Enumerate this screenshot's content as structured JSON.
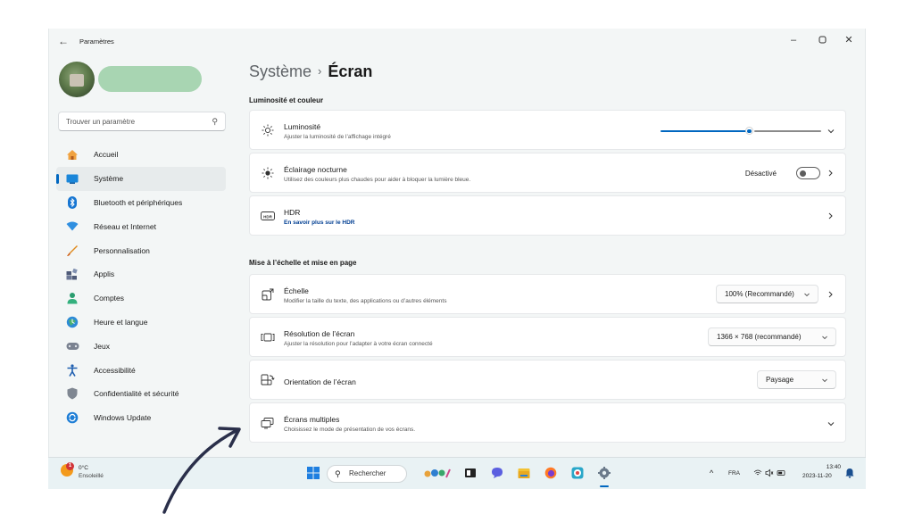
{
  "window": {
    "app_title": "Paramètres",
    "controls": {
      "minimize": "–",
      "maximize": "▢",
      "close": "✕"
    }
  },
  "sidebar": {
    "search_placeholder": "Trouver un paramètre",
    "items": [
      {
        "label": "Accueil",
        "icon": "home-icon",
        "active": false
      },
      {
        "label": "Système",
        "icon": "system-icon",
        "active": true
      },
      {
        "label": "Bluetooth et périphériques",
        "icon": "bluetooth-icon",
        "active": false
      },
      {
        "label": "Réseau et Internet",
        "icon": "network-icon",
        "active": false
      },
      {
        "label": "Personnalisation",
        "icon": "brush-icon",
        "active": false
      },
      {
        "label": "Applis",
        "icon": "apps-icon",
        "active": false
      },
      {
        "label": "Comptes",
        "icon": "accounts-icon",
        "active": false
      },
      {
        "label": "Heure et langue",
        "icon": "time-language-icon",
        "active": false
      },
      {
        "label": "Jeux",
        "icon": "gamepad-icon",
        "active": false
      },
      {
        "label": "Accessibilité",
        "icon": "accessibility-icon",
        "active": false
      },
      {
        "label": "Confidentialité et sécurité",
        "icon": "shield-icon",
        "active": false
      },
      {
        "label": "Windows Update",
        "icon": "windows-update-icon",
        "active": false
      }
    ]
  },
  "breadcrumb": {
    "parent": "Système",
    "separator": "›",
    "current": "Écran"
  },
  "sections": {
    "brightness_color": "Luminosité et couleur",
    "scale_layout": "Mise à l’échelle et mise en page"
  },
  "cards": {
    "brightness": {
      "title": "Luminosité",
      "subtitle": "Ajuster la luminosité de l’affichage intégré",
      "level_percent": 55
    },
    "night_light": {
      "title": "Éclairage nocturne",
      "subtitle": "Utilisez des couleurs plus chaudes pour aider à bloquer la lumière bleue.",
      "state": "Désactivé",
      "on": false
    },
    "hdr": {
      "title": "HDR",
      "subtitle": "En savoir plus sur le HDR"
    },
    "scale": {
      "title": "Échelle",
      "subtitle": "Modifier la taille du texte, des applications ou d’autres éléments",
      "value": "100% (Recommandé)"
    },
    "resolution": {
      "title": "Résolution de l’écran",
      "subtitle": "Ajuster la résolution pour l’adapter à  votre  écran connecté",
      "value": "1366 × 768 (recommandé)"
    },
    "orientation": {
      "title": "Orientation de l’écran",
      "value": "Paysage"
    },
    "multiple_displays": {
      "title": "Écrans multiples",
      "subtitle": "Choisissez le mode de présentation de vos écrans."
    }
  },
  "taskbar": {
    "weather": {
      "temp": "0°C",
      "desc": "Ensoleillé",
      "badge": "1"
    },
    "search_label": "Rechercher",
    "tray": {
      "chevron": "^",
      "language": "FRA",
      "time": "13:40",
      "date": "2023-11-20"
    }
  },
  "colors": {
    "accent": "#0067c0",
    "active_bg": "#e7ebec",
    "window_bg": "#f3f6f6",
    "card_bg": "#ffffff",
    "arrow": "#2a2f4a"
  }
}
